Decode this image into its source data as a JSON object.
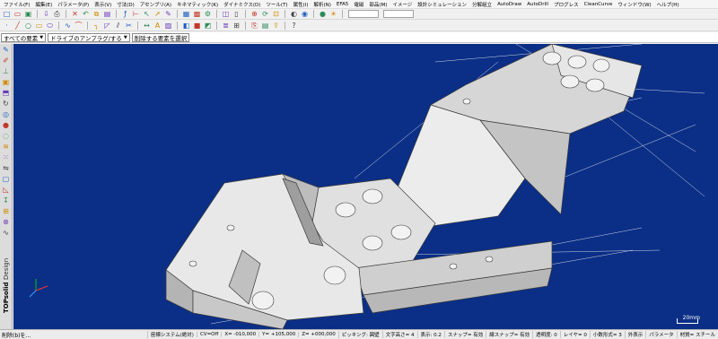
{
  "menu": [
    "ファイル(F)",
    "編集(E)",
    "パラメータ(P)",
    "表示(V)",
    "寸法(D)",
    "アセンブリ(A)",
    "キネマティック(K)",
    "ダイナミクス(D)",
    "ツール(T)",
    "属性(I)",
    "解析(N)",
    "EFA5",
    "電磁",
    "部品(M)",
    "イメージ",
    "設計シミュレーション",
    "分解組立",
    "AutoDraw",
    "AutoDrill",
    "プログレス",
    "CleanCurve",
    "ウィンドウ(W)",
    "ヘルプ(H)"
  ],
  "selection_bar": {
    "scope": "すべての要素",
    "filter": "ドライブのアンプラグ/する",
    "prompt": "削除する要素を選択"
  },
  "brand": {
    "name": "TOPsolid",
    "sub": "Design"
  },
  "scale_label": "20mm",
  "status": {
    "message": "削除(b)を...",
    "items": [
      "座標システム(絶対)",
      "CV=Off",
      "X= -010,000",
      "Y= +105,000",
      "Z= +000,000",
      "ピッキング: 図壁",
      "文字高さ= 4",
      "表示: 0.2",
      "スナップ= 有効",
      "線スナップ= 有効",
      "透明度: 0",
      "レイヤ= 0",
      "小数形式= 3",
      "外表示",
      "パラメータ",
      "材質= スチール"
    ]
  },
  "icons": {
    "toolbar1": [
      "new-file-icon",
      "open-folder-icon",
      "save-icon",
      "separator",
      "import-icon",
      "print-icon",
      "separator",
      "delete-icon",
      "undo-icon",
      "copy-icon",
      "paste-icon",
      "separator",
      "function-icon",
      "measure-icon",
      "pointer-icon",
      "arrow-icon",
      "paint-icon",
      "separator",
      "table-icon",
      "grid-icon",
      "gear-icon",
      "separator",
      "drawing-icon",
      "sheet-icon",
      "separator",
      "zoom-icon",
      "rotate-icon",
      "fit-icon",
      "separator",
      "render-icon",
      "camera-icon",
      "separator",
      "color-icon",
      "light-icon",
      "separator",
      "dropdown",
      "dropdown"
    ],
    "toolbar2": [
      "point-icon",
      "line-icon",
      "circle-icon",
      "rect-icon",
      "ellipse-icon",
      "separator",
      "curve-icon",
      "spline-icon",
      "separator",
      "fillet-icon",
      "chamfer-icon",
      "offset-icon",
      "trim-icon",
      "separator",
      "dimension-icon",
      "text-icon",
      "hatch-icon",
      "separator",
      "view-icon",
      "solid-icon",
      "surface-icon",
      "separator",
      "layer-icon",
      "group-icon",
      "separator",
      "print-preview-icon",
      "pdf-icon",
      "export-icon",
      "separator",
      "help-icon"
    ],
    "left": [
      "pencil-icon",
      "sketch-icon",
      "constraint-icon",
      "cube-icon",
      "extrude-icon",
      "revolve-icon",
      "cylinder-icon",
      "sphere-icon",
      "hole-icon",
      "thread-icon",
      "pattern-icon",
      "mirror-icon",
      "shell-icon",
      "draft-icon",
      "drill-icon",
      "assembly-icon",
      "bolt-icon",
      "spring-icon"
    ]
  },
  "colors": {
    "viewport_bg": "#0b2f86",
    "part_face": "#e4e4e4",
    "edge": "#3a3a3a",
    "construction_line": "#ffffff"
  }
}
